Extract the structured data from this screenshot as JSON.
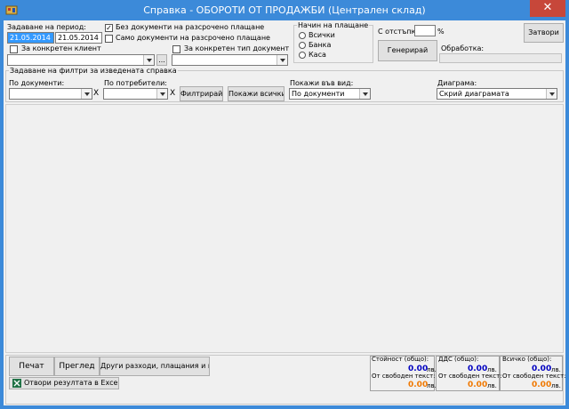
{
  "window": {
    "title": "Справка - ОБОРОТИ ОТ ПРОДАЖБИ (Централен склад)",
    "close_glyph": "✕"
  },
  "period": {
    "label": "Задаване на период:",
    "from": "21.05.2014",
    "to": "21.05.2014"
  },
  "checks": {
    "no_installment": {
      "label": "Без документи на разсрочено плащане",
      "checked": true,
      "mark": "✓"
    },
    "only_installment": {
      "label": "Само документи на разсрочено плащане",
      "checked": false
    },
    "specific_client": {
      "label": "За конкретен клиент",
      "checked": false
    },
    "specific_doc_type": {
      "label": "За конкретен тип документ",
      "checked": false
    }
  },
  "browse_label": "...",
  "payment": {
    "label": "Начин на плащане",
    "options": [
      "Всички",
      "Банка",
      "Каса"
    ]
  },
  "discount": {
    "label": "С отстъпка:",
    "value": "",
    "unit": "%"
  },
  "generate_button": "Генерирай",
  "processing_label": "Обработка:",
  "close_button": "Затвори",
  "filters": {
    "section_label": "Задаване на филтри за изведената справка",
    "by_docs_label": "По документи:",
    "by_users_label": "По потребители:",
    "clear_glyph": "X",
    "filter_button": "Филтрирай",
    "show_all_button": "Покажи всички",
    "view_label": "Покажи във вид:",
    "view_value": "По документи",
    "chart_label": "Диаграма:",
    "chart_value": "Скрий диаграмата"
  },
  "bottom": {
    "print_button": "Печат",
    "preview_button": "Преглед",
    "other_button": "Други разходи, плащания и приходи",
    "excel_button": "Отвори резултата в Excel",
    "totals": [
      {
        "label": "Стойност (общо):",
        "value": "0.00",
        "unit": "лв.",
        "free_label": "От свободен текст:",
        "free_value": "0.00",
        "free_unit": "лв."
      },
      {
        "label": "ДДС (общо):",
        "value": "0.00",
        "unit": "лв.",
        "free_label": "От свободен текст:",
        "free_value": "0.00",
        "free_unit": "лв."
      },
      {
        "label": "Всичко (общо):",
        "value": "0.00",
        "unit": "лв.",
        "free_label": "От свободен текст:",
        "free_value": "0.00",
        "free_unit": "лв."
      }
    ]
  },
  "colors": {
    "titlebar": "#3c8ad9",
    "close": "#c7473a",
    "accent_blue": "#0000c0",
    "accent_orange": "#f07800"
  }
}
